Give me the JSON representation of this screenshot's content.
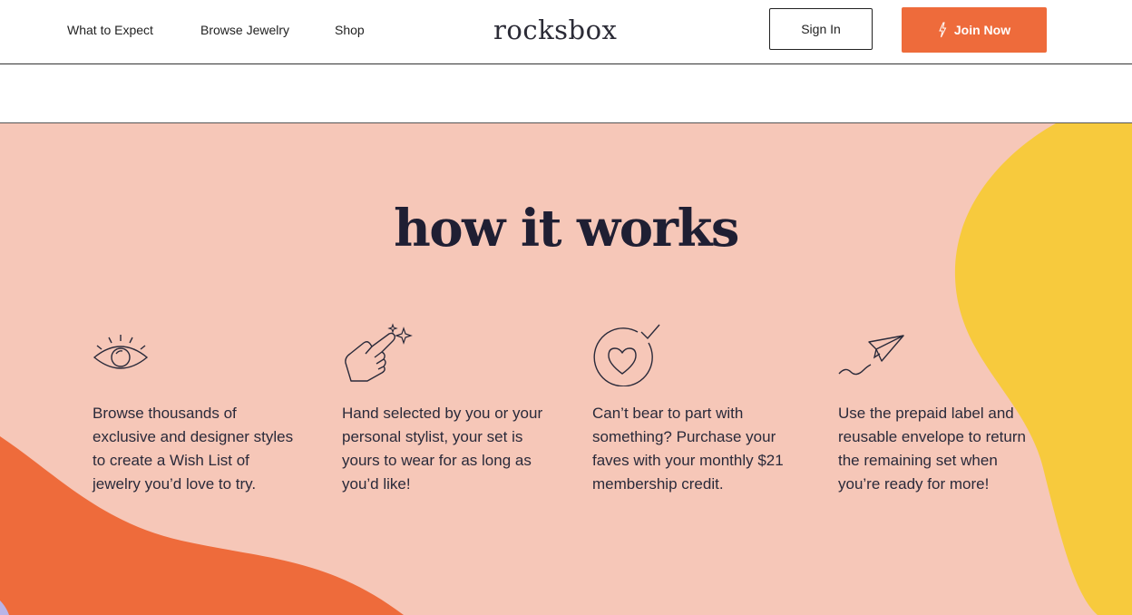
{
  "nav": {
    "links": [
      "What to Expect",
      "Browse Jewelry",
      "Shop"
    ],
    "logo": "rocksbox",
    "sign_in": "Sign In",
    "join_now": "Join Now"
  },
  "how_it_works": {
    "title": "how it works",
    "steps": [
      {
        "icon": "eye-icon",
        "text": "Browse thousands of exclusive and designer styles to create a Wish List of jewelry you’d love to try."
      },
      {
        "icon": "pointing-hand-sparkle-icon",
        "text": "Hand selected by you or your personal stylist, your set is yours to wear for as long as you’d like!"
      },
      {
        "icon": "heart-check-icon",
        "text": "Can’t bear to part with something? Purchase your faves with your monthly $21 membership credit."
      },
      {
        "icon": "paper-plane-icon",
        "text": "Use the prepaid label and reusable envelope to return the remaining set when you’re ready for more!"
      }
    ]
  },
  "colors": {
    "accent_orange": "#ee6b3b",
    "background_pink": "#f6c7b8",
    "yellow_blob": "#f7ca3d",
    "text_dark": "#1f1f33"
  }
}
